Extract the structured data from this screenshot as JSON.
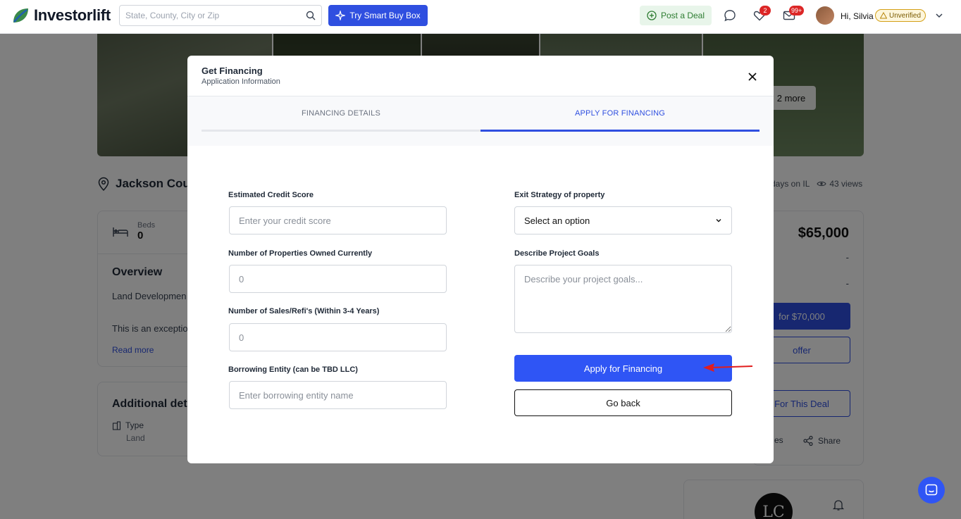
{
  "navbar": {
    "logo_text": "Investorlift",
    "search_placeholder": "State, County, City or Zip",
    "smart_buy_label": "Try Smart Buy Box",
    "post_deal_label": "Post a Deal",
    "likes_badge": "2",
    "messages_badge": "99+",
    "greeting": "Hi, Silvia",
    "status_badge": "Unverified"
  },
  "listing": {
    "gallery_more": "2 more",
    "location_title": "Jackson Cou",
    "days_label": "days on IL",
    "views_label": "43 views",
    "beds_label": "Beds",
    "beds_value": "0",
    "overview_title": "Overview",
    "overview_type": "Land Developmen",
    "overview_desc": "This is an exceptio",
    "read_more": "Read more",
    "additional_title": "Additional det",
    "type_label": "Type",
    "type_value": "Land",
    "price": "$65,000",
    "dash_1": "-",
    "dash_2": "-",
    "offer_primary": "for $70,000",
    "offer_outline": "offer",
    "offer_deal": "For This Deal",
    "notes_label": "es",
    "share_label": "Share",
    "agent_logo_text": "LC"
  },
  "modal": {
    "title": "Get Financing",
    "subtitle": "Application Information",
    "tabs": [
      {
        "label": "FINANCING DETAILS",
        "active": false
      },
      {
        "label": "APPLY FOR FINANCING",
        "active": true
      }
    ],
    "fields": {
      "credit_score": {
        "label": "Estimated Credit Score",
        "placeholder": "Enter your credit score"
      },
      "properties_owned": {
        "label": "Number of Properties Owned Currently",
        "placeholder": "0"
      },
      "sales_refis": {
        "label": "Number of Sales/Refi's (Within 3-4 Years)",
        "placeholder": "0"
      },
      "borrowing_entity": {
        "label": "Borrowing Entity (can be TBD LLC)",
        "placeholder": "Enter borrowing entity name"
      },
      "exit_strategy": {
        "label": "Exit Strategy of property",
        "value": "Select an option"
      },
      "project_goals": {
        "label": "Describe Project Goals",
        "placeholder": "Describe your project goals..."
      }
    },
    "apply_button": "Apply for Financing",
    "back_button": "Go back"
  },
  "colors": {
    "primary": "#2f55f5",
    "annotation_arrow": "#e11d1d",
    "post_deal_bg": "#e8f5ea"
  }
}
